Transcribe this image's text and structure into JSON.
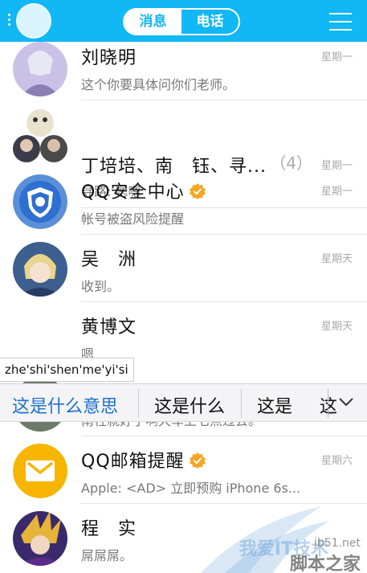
{
  "header": {
    "tabs": [
      {
        "label": "消息",
        "active": true
      },
      {
        "label": "电话",
        "active": false
      }
    ]
  },
  "conversations": [
    {
      "name": "刘晓明",
      "message": "这个你要具体问你们老师。",
      "time": "星期一"
    },
    {
      "name": "丁培培、南　钰、寻...",
      "count": "（4）",
      "message": "寻路: 嗯嗯",
      "time": "星期一"
    },
    {
      "name": "QQ安全中心",
      "message": "帐号被盗风险提醒",
      "time": "星期一",
      "verified": true
    },
    {
      "name": "吴　洲",
      "message": "收到。",
      "time": "星期天"
    },
    {
      "name": "黄博文",
      "message": "嗯",
      "time": "星期天"
    },
    {
      "name": "",
      "message": "南社就好了啊大车上七点过去。",
      "time": ""
    },
    {
      "name": "QQ邮箱提醒",
      "message": "Apple: <AD> 立即预购 iPhone 6s...",
      "time": "星期六",
      "verified": true
    },
    {
      "name": "程　实",
      "message": "屌屌屌。",
      "time": ""
    }
  ],
  "ime": {
    "composition": "zhe'shi'shen'me'yi'si",
    "candidates": [
      "这是什么意思",
      "这是什么",
      "这是",
      "这"
    ]
  },
  "watermark": {
    "line1": "我爱IT技术",
    "line2": "脚本之家",
    "url": "jb51.net"
  },
  "colors": {
    "header": "#12b7f5",
    "badge": "#f5a623",
    "candidate_highlight": "#1f6fd1"
  }
}
